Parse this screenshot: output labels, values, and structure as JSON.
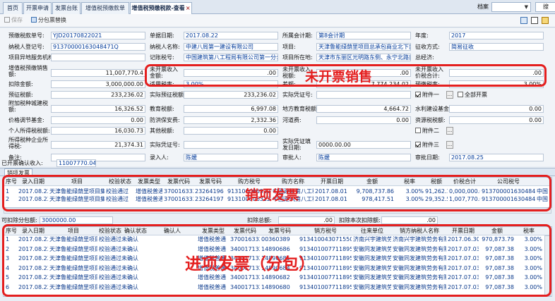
{
  "tabs": [
    "首页",
    "开票申请",
    "发票台账",
    "增值税预缴款单",
    "增值税预缴税款-查看"
  ],
  "tab_close": "×",
  "top_right": {
    "label": "档案",
    "button": "搜"
  },
  "toolbar": {
    "save": "保存",
    "split": "分包票替换"
  },
  "form": {
    "r1": {
      "a_l": "预缴税款单号:",
      "a_v": "YJD20170822021",
      "b_l": "单据日期:",
      "b_v": "2017.08.22",
      "c_l": "所属会计期:",
      "c_v": "第8会计期",
      "d_l": "年度:",
      "d_v": "2017"
    },
    "r2": {
      "a_l": "纳税人登记号:",
      "a_v": "91370000163048471Q",
      "b_l": "纳税人名称:",
      "b_v": "中建八局第一建设有限公司",
      "c_l": "项目:",
      "c_v": "天津鲁能绿荫里项目总承包商业北下部分精装",
      "d_l": "征收方式:",
      "d_v": "简易征收"
    },
    "r3": {
      "a_l": "项目异地服务机构:",
      "b_l": "记账税号:",
      "b_v": "中国建筑第八工程局有限公司第一分公司",
      "c_l": "项目所在地:",
      "c_v": "天津市东丽区光明路东侧、永宁北路南侧、平安路",
      "d_l": "总经济:"
    },
    "r4": {
      "a_l": "增值税预缴销售额:",
      "a_v": "11,007,770.4",
      "b_l": "未开票收入金额:",
      "b_v": ".00",
      "c_l": "未开票收入税额:",
      "c_v": ".00",
      "d_l": "未开票收入价税合计:",
      "d_v": ".00"
    },
    "r5": {
      "a_l": "扣除金额:",
      "a_v": "3,000,000.00",
      "b_l": "适用税率:",
      "b_v": "3.00%",
      "c_l": "差额:",
      "c_v": "7,774,234.02",
      "d_l": "预缴税率:",
      "d_v": "3.00%"
    },
    "r6": {
      "a_l": "预征税额:",
      "a_v": "233,236.02",
      "b_l": "实际预征税额:",
      "b_v": "233,236.02",
      "c_l": "实际凭证号:",
      "d_l": "附件一",
      "e_l": "全部开票"
    },
    "r7": {
      "a_l": "附加税种城建税额:",
      "a_v": "16,326.52",
      "b_l": "教育税额:",
      "b_v": "6,997.08",
      "c_l": "地方教育税额:",
      "c_v": "4,664.72",
      "d_l": "水利建设基金:",
      "d_v": "0.00"
    },
    "r8": {
      "a_l": "价格调节基金:",
      "a_v": "0.00",
      "b_l": "防洪保安费:",
      "b_v": "2,332.36",
      "c_l": "河道费:",
      "c_v": "0.00",
      "d_l": "资源税税额:",
      "d_v": "0.00"
    },
    "r9": {
      "a_l": "个人所得税税额:",
      "a_v": "16,030.73",
      "b_l": "其他税额:",
      "b_v": "0.00",
      "d_l": "附件二"
    },
    "r10": {
      "a_l": "所得税种企业所得税:",
      "a_v": "21,374.31",
      "b_l": "实际凭证号:",
      "c_l": "实际凭证填发日期:",
      "c_v": "0000.00.00",
      "d_l": "附件三"
    },
    "r11": {
      "a_l": "备注:",
      "b_l": "录入人:",
      "b_v": "陈媛",
      "c_l": "审批人:",
      "c_v": "陈媛",
      "d_l": "审批日期:",
      "d_v": "2017.08.25"
    },
    "r12": {
      "a_l": "已开票确认收入:",
      "a_v": "11007770.04"
    }
  },
  "sales": {
    "section": "销项发票",
    "columns": [
      "序号",
      "录入日期",
      "项目",
      "校验状态",
      "发票类型",
      "发票代码",
      "发票号码",
      "购方税号",
      "购方名称",
      "开票日期",
      "金额",
      "税率",
      "税额",
      "价税合计",
      "公司税号"
    ],
    "rows": [
      [
        "1",
        "2017.08.22",
        "天津鲁能绿荫里项目集",
        "校验通过",
        "增值税普通",
        "3700163320",
        "23264196",
        "91310000631265030",
        "中国建筑第八工程局",
        "2017.08.01",
        "9,708,737.86",
        "3.00%",
        "91,262.14",
        "0,000,000.00",
        "91370000163048471Q",
        "中国"
      ],
      [
        "2",
        "2017.08.22",
        "天津鲁能绿荫里项目集",
        "校验通过",
        "增值税普通",
        "3700163320",
        "23264197",
        "91310000631265030",
        "中国建筑第八工程局",
        "2017.08.01",
        "978,417.51",
        "3.00%",
        "29,352.53",
        "1,007,770.04",
        "91370000163048471Q",
        "中国"
      ]
    ]
  },
  "deduct": {
    "label1": "可扣除分包额:",
    "value1": "3000000.00",
    "label2": "扣除总额:",
    "value2": ".00",
    "label3": "扣除本次扣除额:",
    "value3": ".00"
  },
  "input": {
    "columns": [
      "序号",
      "录入日期",
      "项目",
      "校验状态",
      "确认状态",
      "确认人",
      "发票类型",
      "发票代码",
      "发票号码",
      "销方税号",
      "往来单位",
      "销方纳税人名称",
      "开票日期",
      "金额",
      "税率"
    ],
    "rows": [
      [
        "1",
        "2017.08.22",
        "天津鲁能绿荫里项目",
        "校验通过",
        "未确认",
        "",
        "增值税普通",
        "3700163320",
        "00360389",
        "913410043071550",
        "济南兴宇建筑劳务有限公司",
        "济南兴宇建筑劳务有限公司",
        "2017.06.30",
        "970,873.79",
        "3.00%"
      ],
      [
        "2",
        "2017.08.22",
        "天津鲁能绿荫里项目",
        "校验通过",
        "未确认",
        "",
        "增值税普通",
        "3400171320",
        "14890686",
        "913401007711895",
        "安徽同发建筑劳务有限公司",
        "安徽同发建筑劳务有限公司",
        "2017.07.03",
        "97,087.38",
        "3.00%"
      ],
      [
        "3",
        "2017.08.22",
        "天津鲁能绿荫里项目",
        "校验通过",
        "未确认",
        "",
        "增值税普通",
        "3400171320",
        "14890685",
        "913401007711895",
        "安徽同发建筑劳务有限公司",
        "安徽同发建筑劳务有限公司",
        "2017.07.03",
        "97,087.38",
        "3.00%"
      ],
      [
        "4",
        "2017.08.22",
        "天津鲁能绿荫里项目",
        "校验通过",
        "未确认",
        "",
        "增值税普通",
        "3400171320",
        "14890684",
        "913401007711895",
        "安徽同发建筑劳务有限公司",
        "安徽同发建筑劳务有限公司",
        "2017.07.03",
        "97,087.38",
        "3.00%"
      ],
      [
        "5",
        "2017.08.22",
        "天津鲁能绿荫里项目",
        "校验通过",
        "未确认",
        "",
        "增值税普通",
        "3400171320",
        "14890682",
        "913401007711895",
        "安徽同发建筑劳务有限公司",
        "安徽同发建筑劳务有限公司",
        "2017.07.03",
        "97,087.38",
        "3.00%"
      ],
      [
        "6",
        "2017.08.22",
        "天津鲁能绿荫里项目",
        "校验通过",
        "未确认",
        "",
        "增值税普通",
        "3400171320",
        "14890680",
        "913401007711895",
        "安徽同发建筑劳务有限公司",
        "安徽同发建筑劳务有限公司",
        "2017.07.03",
        "97,087.38",
        "3.00%"
      ]
    ]
  },
  "annotations": {
    "unbilled": "未开票销售",
    "sales": "销项发票",
    "input": "进项发票（分包）"
  },
  "colors": {
    "annotation_red": "#e41f1f",
    "value_blue": "#0b3a8c"
  }
}
